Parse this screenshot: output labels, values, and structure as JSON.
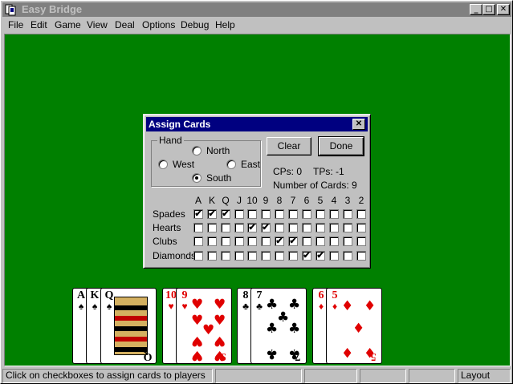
{
  "window": {
    "title": "Easy Bridge",
    "controls": {
      "min": "_",
      "max": "□",
      "close": "✕"
    }
  },
  "menu": [
    "File",
    "Edit",
    "Game",
    "View",
    "Deal",
    "Options",
    "Debug",
    "Help"
  ],
  "dialog": {
    "title": "Assign Cards",
    "close": "✕",
    "hand_group": "Hand",
    "hands": {
      "north": "North",
      "west": "West",
      "east": "East",
      "south": "South"
    },
    "selected_hand": "South",
    "clear_label": "Clear",
    "done_label": "Done",
    "cps": "CPs: 0",
    "tps": "TPs: -1",
    "num_cards": "Number of Cards:  9",
    "ranks": [
      "A",
      "K",
      "Q",
      "J",
      "10",
      "9",
      "8",
      "7",
      "6",
      "5",
      "4",
      "3",
      "2"
    ],
    "suits": [
      "Spades",
      "Hearts",
      "Clubs",
      "Diamonds"
    ],
    "checked": {
      "Spades": [
        "A",
        "K",
        "Q"
      ],
      "Hearts": [
        "10",
        "9"
      ],
      "Clubs": [
        "8",
        "7"
      ],
      "Diamonds": [
        "6",
        "5"
      ]
    },
    "check_mark": "✔"
  },
  "cards": [
    {
      "rank": "A",
      "suit": "♠",
      "color": "black"
    },
    {
      "rank": "K",
      "suit": "♠",
      "color": "black"
    },
    {
      "rank": "Q",
      "suit": "♠",
      "color": "black"
    },
    {
      "rank": "10",
      "suit": "♥",
      "color": "red"
    },
    {
      "rank": "9",
      "suit": "♥",
      "color": "red"
    },
    {
      "rank": "8",
      "suit": "♣",
      "color": "black"
    },
    {
      "rank": "7",
      "suit": "♣",
      "color": "black"
    },
    {
      "rank": "6",
      "suit": "♦",
      "color": "red"
    },
    {
      "rank": "5",
      "suit": "♦",
      "color": "red"
    }
  ],
  "status": {
    "message": "Click on checkboxes to assign cards to players",
    "layout": "Layout"
  },
  "colors": {
    "felt": "#008000",
    "dialog_title": "#000080",
    "card_red": "#e00000"
  }
}
